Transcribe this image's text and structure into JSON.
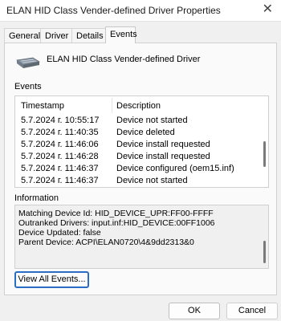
{
  "window": {
    "title": "ELAN HID Class Vender-defined Driver Properties",
    "close_glyph": "✕"
  },
  "tabs": [
    {
      "label": "General",
      "active": false
    },
    {
      "label": "Driver",
      "active": false
    },
    {
      "label": "Details",
      "active": false
    },
    {
      "label": "Events",
      "active": true
    }
  ],
  "device": {
    "name": "ELAN HID Class Vender-defined Driver",
    "icon": "hid-device-icon"
  },
  "events": {
    "label": "Events",
    "columns": [
      "Timestamp",
      "Description"
    ],
    "rows": [
      {
        "timestamp": "5.7.2024 г. 10:55:17",
        "description": "Device not started"
      },
      {
        "timestamp": "5.7.2024 г. 11:40:35",
        "description": "Device deleted"
      },
      {
        "timestamp": "5.7.2024 г. 11:46:06",
        "description": "Device install requested"
      },
      {
        "timestamp": "5.7.2024 г. 11:46:28",
        "description": "Device install requested"
      },
      {
        "timestamp": "5.7.2024 г. 11:46:37",
        "description": "Device configured (oem15.inf)"
      },
      {
        "timestamp": "5.7.2024 г. 11:46:37",
        "description": "Device not started"
      }
    ]
  },
  "information": {
    "label": "Information",
    "lines": [
      "Matching Device Id: HID_DEVICE_UPR:FF00-FFFF",
      "Outranked Drivers: input.inf:HID_DEVICE:00FF1006",
      "Device Updated: false",
      "Parent Device: ACPI\\ELAN0720\\4&9dd2313&0"
    ]
  },
  "buttons": {
    "view_all": "View All Events...",
    "ok": "OK",
    "cancel": "Cancel"
  },
  "colors": {
    "accent": "#2b6cc4",
    "window_bg": "#f0f0f0",
    "panel_bg": "#fafafa"
  }
}
